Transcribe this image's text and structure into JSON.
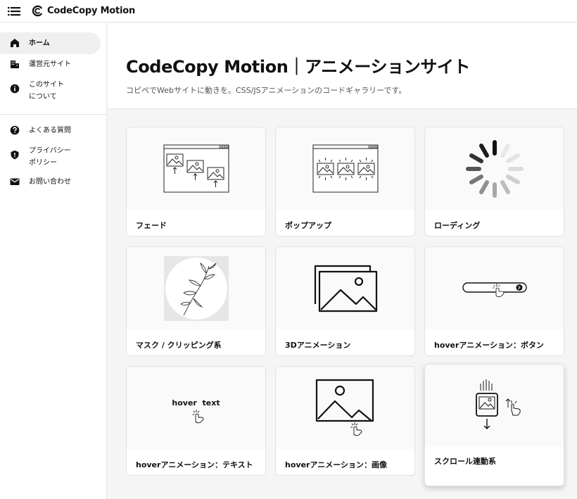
{
  "header": {
    "logo_text": "CodeCopy Motion",
    "icons": [
      "menu-icon",
      "logo-icon"
    ]
  },
  "sidebar": {
    "items": [
      {
        "label": "ホーム",
        "icon": "home-icon",
        "active": true
      },
      {
        "label": "運営元サイト",
        "icon": "building-icon"
      },
      {
        "label": "このサイト\nについて",
        "icon": "info-icon"
      },
      {
        "label": "よくある質問",
        "icon": "question-icon"
      },
      {
        "label": "プライバシー\nポリシー",
        "icon": "shield-icon"
      },
      {
        "label": "お問い合わせ",
        "icon": "mail-icon"
      }
    ]
  },
  "hero": {
    "title": "CodeCopy Motion｜アニメーションサイト",
    "subtitle": "コピペでWebサイトに動きを。CSS/JSアニメーションのコードギャラリーです。"
  },
  "cards": [
    {
      "label": "フェード",
      "thumb": "fade-thumbnail"
    },
    {
      "label": "ポップアップ",
      "thumb": "popup-thumbnail"
    },
    {
      "label": "ローディング",
      "thumb": "loading-spinner-thumbnail"
    },
    {
      "label": "マスク / クリッピング系",
      "thumb": "mask-clipping-thumbnail"
    },
    {
      "label": "3Dアニメーション",
      "thumb": "3d-animation-thumbnail"
    },
    {
      "label": "hoverアニメーション：ボタン",
      "thumb": "hover-button-thumbnail"
    },
    {
      "label": "hoverアニメーション：テキスト",
      "thumb": "hover-text-thumbnail",
      "thumb_text": "hover  text"
    },
    {
      "label": "hoverアニメーション：画像",
      "thumb": "hover-image-thumbnail"
    },
    {
      "label": "スクロール連動系",
      "thumb": "scroll-thumbnail"
    }
  ],
  "colors": {
    "accent": "#111111",
    "background": "#f5f5f5",
    "card": "#ffffff"
  }
}
